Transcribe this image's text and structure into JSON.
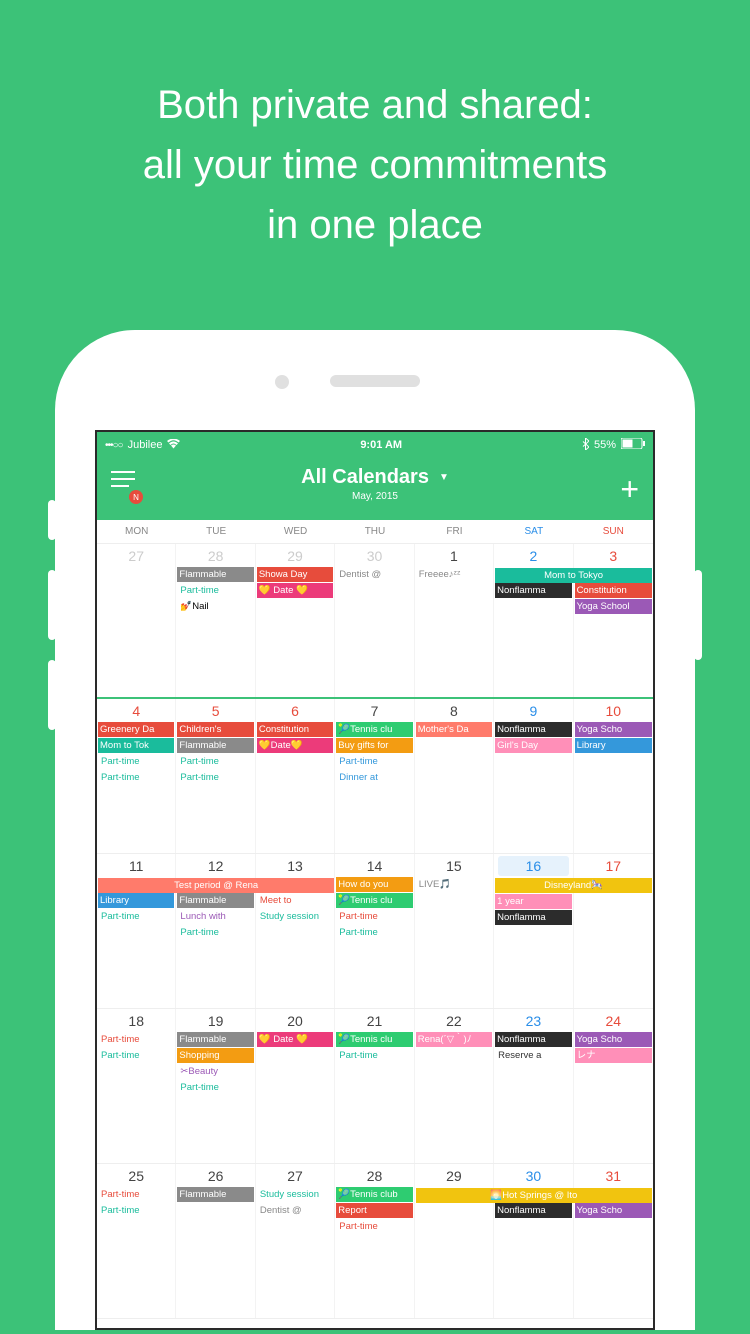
{
  "promo": {
    "line1": "Both private and shared:",
    "line2": "all your time commitments",
    "line3": "in one place"
  },
  "statusBar": {
    "carrier": "Jubilee",
    "time": "9:01 AM",
    "battery": "55%",
    "signal": "•••○○"
  },
  "nav": {
    "title": "All Calendars",
    "subtitle": "May, 2015",
    "badge": "N"
  },
  "weekdays": [
    "MON",
    "TUE",
    "WED",
    "THU",
    "FRI",
    "SAT",
    "SUN"
  ],
  "weeks": [
    {
      "days": [
        {
          "num": "27",
          "cls": "prev"
        },
        {
          "num": "28",
          "cls": "prev"
        },
        {
          "num": "29",
          "cls": "prev"
        },
        {
          "num": "30",
          "cls": "prev"
        },
        {
          "num": "1",
          "cls": ""
        },
        {
          "num": "2",
          "cls": "sat"
        },
        {
          "num": "3",
          "cls": "sun"
        }
      ],
      "spans": [
        {
          "text": "Mom to Tokyo",
          "cls": "c-cyan",
          "col": 6,
          "colspan": 2,
          "row": 0
        }
      ],
      "events": [
        [],
        [
          {
            "t": "Flammable",
            "c": "c-gray"
          },
          {
            "t": "Part-time",
            "c": "txt t-cyan"
          },
          {
            "t": "💅Nail",
            "c": "txt"
          }
        ],
        [
          {
            "t": "Showa Day",
            "c": "c-red"
          },
          {
            "t": "💛 Date 💛",
            "c": "c-pink"
          }
        ],
        [
          {
            "t": "Dentist @",
            "c": "txt t-gray"
          }
        ],
        [
          {
            "t": "Freeee♪ᶻᶻ",
            "c": "txt t-gray"
          }
        ],
        [
          {
            "t": "",
            "c": ""
          },
          {
            "t": "Nonflamma",
            "c": "c-black"
          }
        ],
        [
          {
            "t": "",
            "c": ""
          },
          {
            "t": "Constitution",
            "c": "c-red"
          },
          {
            "t": "Yoga School",
            "c": "c-purple"
          }
        ]
      ]
    },
    {
      "days": [
        {
          "num": "4",
          "cls": "hol"
        },
        {
          "num": "5",
          "cls": "hol"
        },
        {
          "num": "6",
          "cls": "hol"
        },
        {
          "num": "7",
          "cls": ""
        },
        {
          "num": "8",
          "cls": ""
        },
        {
          "num": "9",
          "cls": "sat"
        },
        {
          "num": "10",
          "cls": "sun"
        }
      ],
      "spans": [],
      "events": [
        [
          {
            "t": "Greenery Da",
            "c": "c-red"
          },
          {
            "t": "Mom to Tok",
            "c": "c-cyan"
          },
          {
            "t": "Part-time",
            "c": "txt t-cyan"
          },
          {
            "t": "Part-time",
            "c": "txt t-cyan"
          }
        ],
        [
          {
            "t": "Children's",
            "c": "c-red"
          },
          {
            "t": "Flammable",
            "c": "c-gray"
          },
          {
            "t": "Part-time",
            "c": "txt t-cyan"
          },
          {
            "t": "Part-time",
            "c": "txt t-cyan"
          }
        ],
        [
          {
            "t": "Constitution",
            "c": "c-red"
          },
          {
            "t": "💛Date💛",
            "c": "c-pink"
          }
        ],
        [
          {
            "t": "🎾Tennis clu",
            "c": "c-green"
          },
          {
            "t": "Buy gifts for",
            "c": "c-orange"
          },
          {
            "t": "Part-time",
            "c": "txt t-blue"
          },
          {
            "t": "Dinner at",
            "c": "txt t-blue"
          }
        ],
        [
          {
            "t": "Mother's Da",
            "c": "c-salmon"
          }
        ],
        [
          {
            "t": "Nonflamma",
            "c": "c-black"
          },
          {
            "t": "Girl's Day",
            "c": "c-lpink"
          }
        ],
        [
          {
            "t": "Yoga Scho",
            "c": "c-purple"
          },
          {
            "t": "Library",
            "c": "c-blue"
          }
        ]
      ]
    },
    {
      "days": [
        {
          "num": "11",
          "cls": ""
        },
        {
          "num": "12",
          "cls": ""
        },
        {
          "num": "13",
          "cls": ""
        },
        {
          "num": "14",
          "cls": ""
        },
        {
          "num": "15",
          "cls": ""
        },
        {
          "num": "16",
          "cls": "sat-hl"
        },
        {
          "num": "17",
          "cls": "sun"
        }
      ],
      "spans": [
        {
          "text": "Test period @ Rena",
          "cls": "c-salmon",
          "col": 1,
          "colspan": 3,
          "row": 0
        },
        {
          "text": "Disneyland🎠",
          "cls": "c-yellow",
          "col": 6,
          "colspan": 2,
          "row": 0
        }
      ],
      "events": [
        [
          {
            "t": "",
            "c": ""
          },
          {
            "t": "Library",
            "c": "c-blue"
          },
          {
            "t": "Part-time",
            "c": "txt t-cyan"
          }
        ],
        [
          {
            "t": "",
            "c": ""
          },
          {
            "t": "Flammable",
            "c": "c-gray"
          },
          {
            "t": "Lunch with",
            "c": "txt t-purple"
          },
          {
            "t": "Part-time",
            "c": "txt t-cyan"
          }
        ],
        [
          {
            "t": "",
            "c": ""
          },
          {
            "t": "Meet to",
            "c": "txt t-red"
          },
          {
            "t": "Study session",
            "c": "txt t-cyan"
          }
        ],
        [
          {
            "t": "How do you",
            "c": "c-orange"
          },
          {
            "t": "🎾Tennis clu",
            "c": "c-green"
          },
          {
            "t": "Part-time",
            "c": "txt t-red"
          },
          {
            "t": "Part-time",
            "c": "txt t-cyan"
          }
        ],
        [
          {
            "t": "LIVE🎵",
            "c": "txt t-gray"
          }
        ],
        [
          {
            "t": "",
            "c": ""
          },
          {
            "t": "1 year",
            "c": "c-lpink"
          },
          {
            "t": "Nonflamma",
            "c": "c-black"
          }
        ],
        [
          {
            "t": "",
            "c": ""
          }
        ]
      ]
    },
    {
      "days": [
        {
          "num": "18",
          "cls": ""
        },
        {
          "num": "19",
          "cls": ""
        },
        {
          "num": "20",
          "cls": ""
        },
        {
          "num": "21",
          "cls": ""
        },
        {
          "num": "22",
          "cls": ""
        },
        {
          "num": "23",
          "cls": "sat"
        },
        {
          "num": "24",
          "cls": "sun"
        }
      ],
      "spans": [],
      "events": [
        [
          {
            "t": "Part-time",
            "c": "txt t-red"
          },
          {
            "t": "Part-time",
            "c": "txt t-cyan"
          }
        ],
        [
          {
            "t": "Flammable",
            "c": "c-gray"
          },
          {
            "t": "Shopping",
            "c": "c-orange"
          },
          {
            "t": "✂Beauty",
            "c": "txt t-purple"
          },
          {
            "t": "Part-time",
            "c": "txt t-cyan"
          }
        ],
        [
          {
            "t": "💛 Date 💛",
            "c": "c-pink"
          }
        ],
        [
          {
            "t": "🎾Tennis clu",
            "c": "c-green"
          },
          {
            "t": "Part-time",
            "c": "txt t-cyan"
          }
        ],
        [
          {
            "t": "Rena(´▽｀)ﾉ",
            "c": "c-lpink"
          }
        ],
        [
          {
            "t": "Nonflamma",
            "c": "c-black"
          },
          {
            "t": "Reserve a",
            "c": "txt t-black"
          }
        ],
        [
          {
            "t": "Yoga Scho",
            "c": "c-purple"
          },
          {
            "t": "レナ",
            "c": "c-lpink"
          }
        ]
      ]
    },
    {
      "days": [
        {
          "num": "25",
          "cls": ""
        },
        {
          "num": "26",
          "cls": ""
        },
        {
          "num": "27",
          "cls": ""
        },
        {
          "num": "28",
          "cls": ""
        },
        {
          "num": "29",
          "cls": ""
        },
        {
          "num": "30",
          "cls": "sat"
        },
        {
          "num": "31",
          "cls": "sun"
        }
      ],
      "spans": [
        {
          "text": "🌅Hot Springs @ Ito",
          "cls": "c-yellow",
          "col": 5,
          "colspan": 3,
          "row": 0
        }
      ],
      "events": [
        [
          {
            "t": "Part-time",
            "c": "txt t-red"
          },
          {
            "t": "Part-time",
            "c": "txt t-cyan"
          }
        ],
        [
          {
            "t": "Flammable",
            "c": "c-gray"
          }
        ],
        [
          {
            "t": "Study session",
            "c": "txt t-cyan"
          },
          {
            "t": "Dentist @",
            "c": "txt t-gray"
          }
        ],
        [
          {
            "t": "🎾Tennis club",
            "c": "c-green"
          },
          {
            "t": "Report",
            "c": "c-red"
          },
          {
            "t": "Part-time",
            "c": "txt t-red"
          }
        ],
        [],
        [
          {
            "t": "",
            "c": ""
          },
          {
            "t": "Nonflamma",
            "c": "c-black"
          }
        ],
        [
          {
            "t": "",
            "c": ""
          },
          {
            "t": "Yoga Scho",
            "c": "c-purple"
          }
        ]
      ]
    }
  ]
}
